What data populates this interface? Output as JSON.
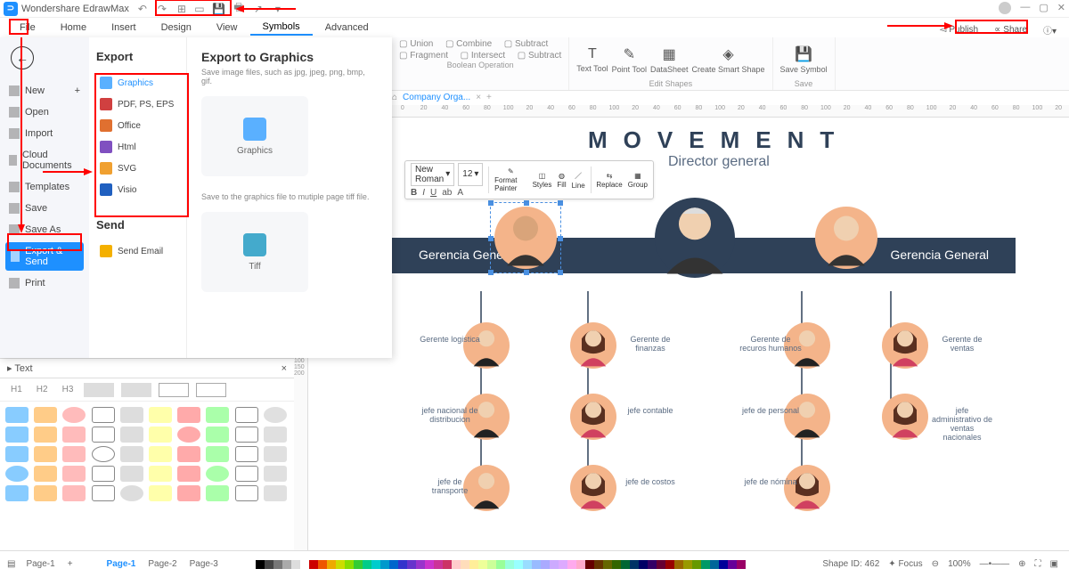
{
  "app": {
    "name": "Wondershare EdrawMax"
  },
  "menubar": [
    "File",
    "Home",
    "Insert",
    "Design",
    "View",
    "Symbols",
    "Advanced"
  ],
  "menubar_active": 5,
  "ribbon": {
    "bool": {
      "items": [
        [
          "▢ ",
          "Union"
        ],
        [
          "▢ ",
          "Combine"
        ],
        [
          "▢ ",
          "Subtract"
        ],
        [
          "▢ ",
          "Fragment"
        ],
        [
          "▢ ",
          "Intersect"
        ],
        [
          "▢ ",
          "Subtract"
        ]
      ],
      "label": "Boolean Operation"
    },
    "edit": {
      "items": [
        "Text Tool",
        "Point Tool",
        "DataSheet",
        "Create Smart Shape"
      ],
      "label": "Edit Shapes"
    },
    "save": {
      "items": [
        "Save Symbol"
      ],
      "label": "Save"
    }
  },
  "topright": {
    "publish": "Publish",
    "share": "Share"
  },
  "filemenu": {
    "left": [
      "New",
      "Open",
      "Import",
      "Cloud Documents",
      "Templates",
      "Save",
      "Save As",
      "Export & Send",
      "Print"
    ],
    "export_h": "Export",
    "send_h": "Send",
    "exports": [
      "Graphics",
      "PDF, PS, EPS",
      "Office",
      "Html",
      "SVG",
      "Visio"
    ],
    "send": "Send Email",
    "right_h": "Export to Graphics",
    "right_sub": "Save image files, such as jpg, jpeg, png, bmp, gif.",
    "card1": "Graphics",
    "right_sub2": "Save to the graphics file to mutiple page tiff file.",
    "card2": "Tiff"
  },
  "doctab": {
    "name": "Company Orga..."
  },
  "ruler": [
    "0",
    "20",
    "40",
    "60",
    "80",
    "100",
    "20",
    "40",
    "60",
    "80",
    "100",
    "20",
    "40",
    "60",
    "80",
    "100",
    "20",
    "40",
    "60",
    "80",
    "100",
    "20",
    "40",
    "60",
    "80",
    "100",
    "20",
    "40",
    "60",
    "80",
    "100",
    "20"
  ],
  "floattb": {
    "font": "New Roman",
    "size": "12",
    "items": [
      "B",
      "I",
      "U",
      "ab",
      "A",
      "Format Painter",
      "Styles",
      "Fill",
      "Line",
      "Replace",
      "Group"
    ]
  },
  "org": {
    "title": "MOVEMENT",
    "director": "Director general",
    "band_left": "Gerencia General",
    "band_right": "Gerencia General",
    "row2": [
      "Gerente logistica",
      "Gerente de finanzas",
      "Gerente de recuros humanos",
      "Gerente de ventas"
    ],
    "row3": [
      "jefe nacional de distribucion",
      "jefe contable",
      "jefe de personal",
      "jefe administrativo de ventas nacionales"
    ],
    "row4": [
      "jefe de transporte",
      "jefe de costos",
      "jefe de nómina",
      ""
    ]
  },
  "leftpanel": {
    "title": "Text",
    "h": [
      "H1",
      "H2",
      "H3"
    ]
  },
  "statusbar": {
    "leftTabs": [
      "Page-1"
    ],
    "centerTabs": [
      "Page-1",
      "Page-2",
      "Page-3"
    ],
    "shapeid": "Shape ID: 462",
    "focus": "Focus",
    "zoom": "100%"
  },
  "palette": [
    "#000",
    "#444",
    "#777",
    "#aaa",
    "#ddd",
    "#fff",
    "#c00",
    "#e50",
    "#ea0",
    "#cd0",
    "#8d0",
    "#3c3",
    "#0c8",
    "#0cc",
    "#09c",
    "#06c",
    "#33c",
    "#63c",
    "#93c",
    "#c3c",
    "#c39",
    "#c36",
    "#fcc",
    "#fdb",
    "#fe9",
    "#ef9",
    "#cf9",
    "#9f9",
    "#9fd",
    "#9ff",
    "#9df",
    "#9bf",
    "#aaf",
    "#caf",
    "#daf",
    "#fae",
    "#fac",
    "#600",
    "#630",
    "#660",
    "#360",
    "#063",
    "#036",
    "#006",
    "#306",
    "#603",
    "#900",
    "#960",
    "#990",
    "#690",
    "#096",
    "#069",
    "#009",
    "#609",
    "#906"
  ]
}
